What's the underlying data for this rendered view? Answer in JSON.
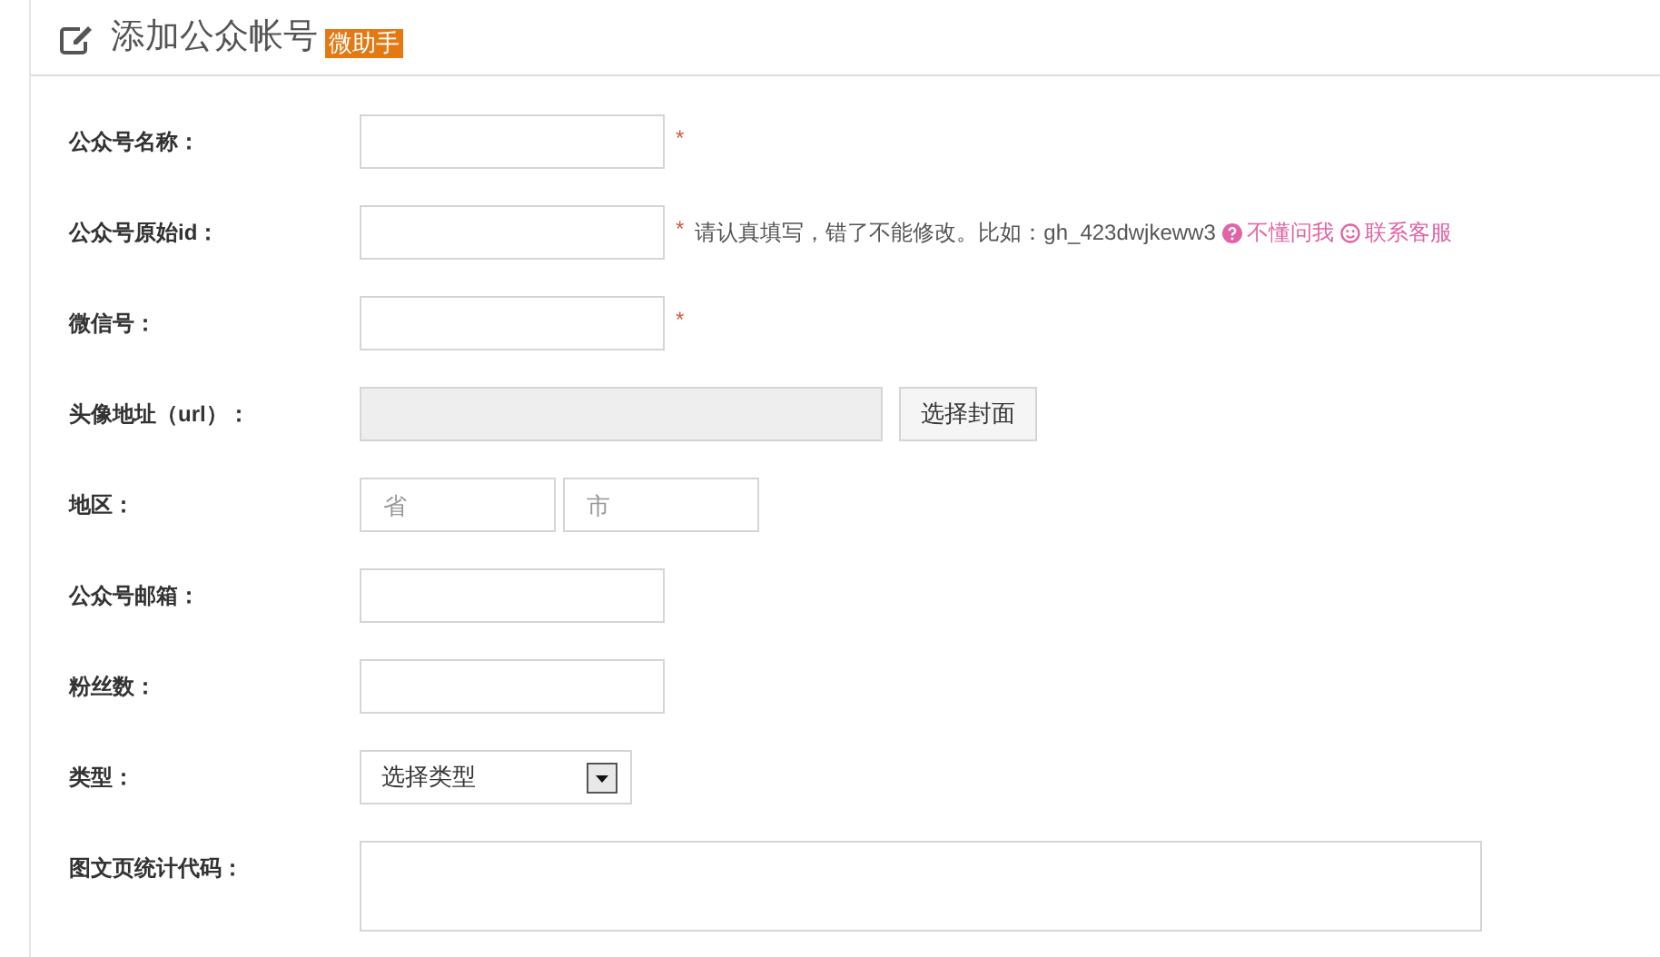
{
  "header": {
    "title": "添加公众帐号",
    "badge": "微助手"
  },
  "fields": [
    {
      "kind": "text",
      "label": "公众号名称：",
      "required_mark": "*"
    },
    {
      "kind": "text",
      "label": "公众号原始id：",
      "required_mark": "*",
      "hint": "请认真填写，错了不能修改。比如：gh_423dwjkeww3",
      "links": [
        "不懂问我",
        "联系客服"
      ]
    },
    {
      "kind": "text",
      "label": "微信号：",
      "required_mark": "*"
    },
    {
      "kind": "url",
      "label": "头像地址（url）：",
      "button": "选择封面"
    },
    {
      "kind": "region",
      "label": "地区：",
      "placeholders": [
        "省",
        "市"
      ]
    },
    {
      "kind": "text",
      "label": "公众号邮箱："
    },
    {
      "kind": "text",
      "label": "粉丝数："
    },
    {
      "kind": "select",
      "label": "类型：",
      "value": "选择类型"
    },
    {
      "kind": "textarea",
      "label": "图文页统计代码："
    }
  ]
}
